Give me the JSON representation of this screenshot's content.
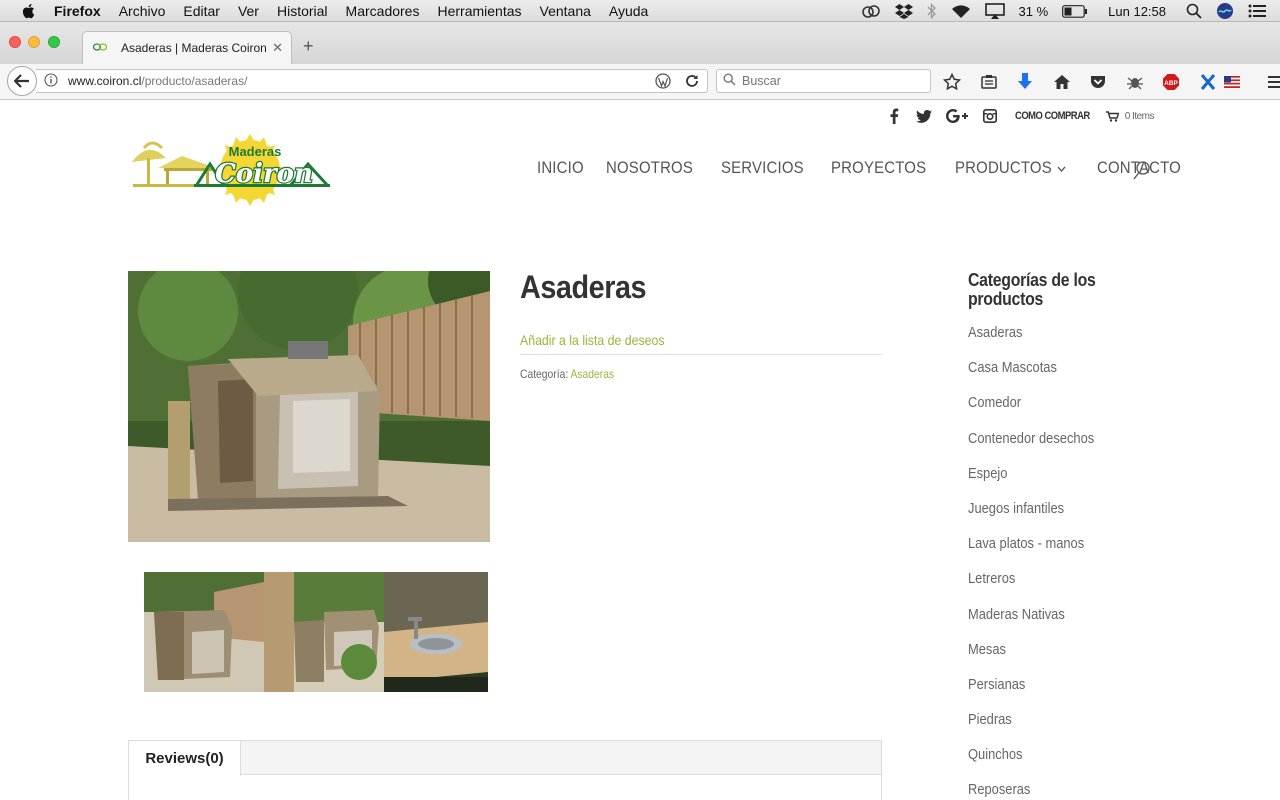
{
  "mac_menubar": {
    "app_name": "Firefox",
    "items": [
      "Archivo",
      "Editar",
      "Ver",
      "Historial",
      "Marcadores",
      "Herramientas",
      "Ventana",
      "Ayuda"
    ],
    "battery": "31 %",
    "clock": "Lun 12:58"
  },
  "browser": {
    "tab_title": "Asaderas | Maderas Coiron",
    "url_host": "www.coiron.cl",
    "url_path": "/producto/asaderas/",
    "search_placeholder": "Buscar"
  },
  "site": {
    "topbar": {
      "como_comprar": "COMO COMPRAR",
      "cart": "0 Items"
    },
    "logo_text": {
      "top": "Maderas",
      "main": "Coiron"
    },
    "nav": {
      "inicio": "INICIO",
      "nosotros": "NOSOTROS",
      "servicios": "SERVICIOS",
      "proyectos": "PROYECTOS",
      "productos": "PRODUCTOS",
      "contacto": "CONTACTO"
    },
    "product": {
      "title": "Asaderas",
      "wishlist": "Añadir a la lista de deseos",
      "category_label": "Categoría:",
      "category_value": "Asaderas"
    },
    "reviews_tab": "Reviews(0)",
    "sidebar": {
      "title": "Categorías de los productos",
      "items": [
        "Asaderas",
        "Casa Mascotas",
        "Comedor",
        "Contenedor desechos",
        "Espejo",
        "Juegos infantiles",
        "Lava platos - manos",
        "Letreros",
        "Maderas Nativas",
        "Mesas",
        "Persianas",
        "Piedras",
        "Quinchos",
        "Reposeras"
      ]
    }
  },
  "colors": {
    "accent_green": "#9cb53b",
    "logo_green": "#1d7a33",
    "logo_yellow": "#f2d03a"
  }
}
